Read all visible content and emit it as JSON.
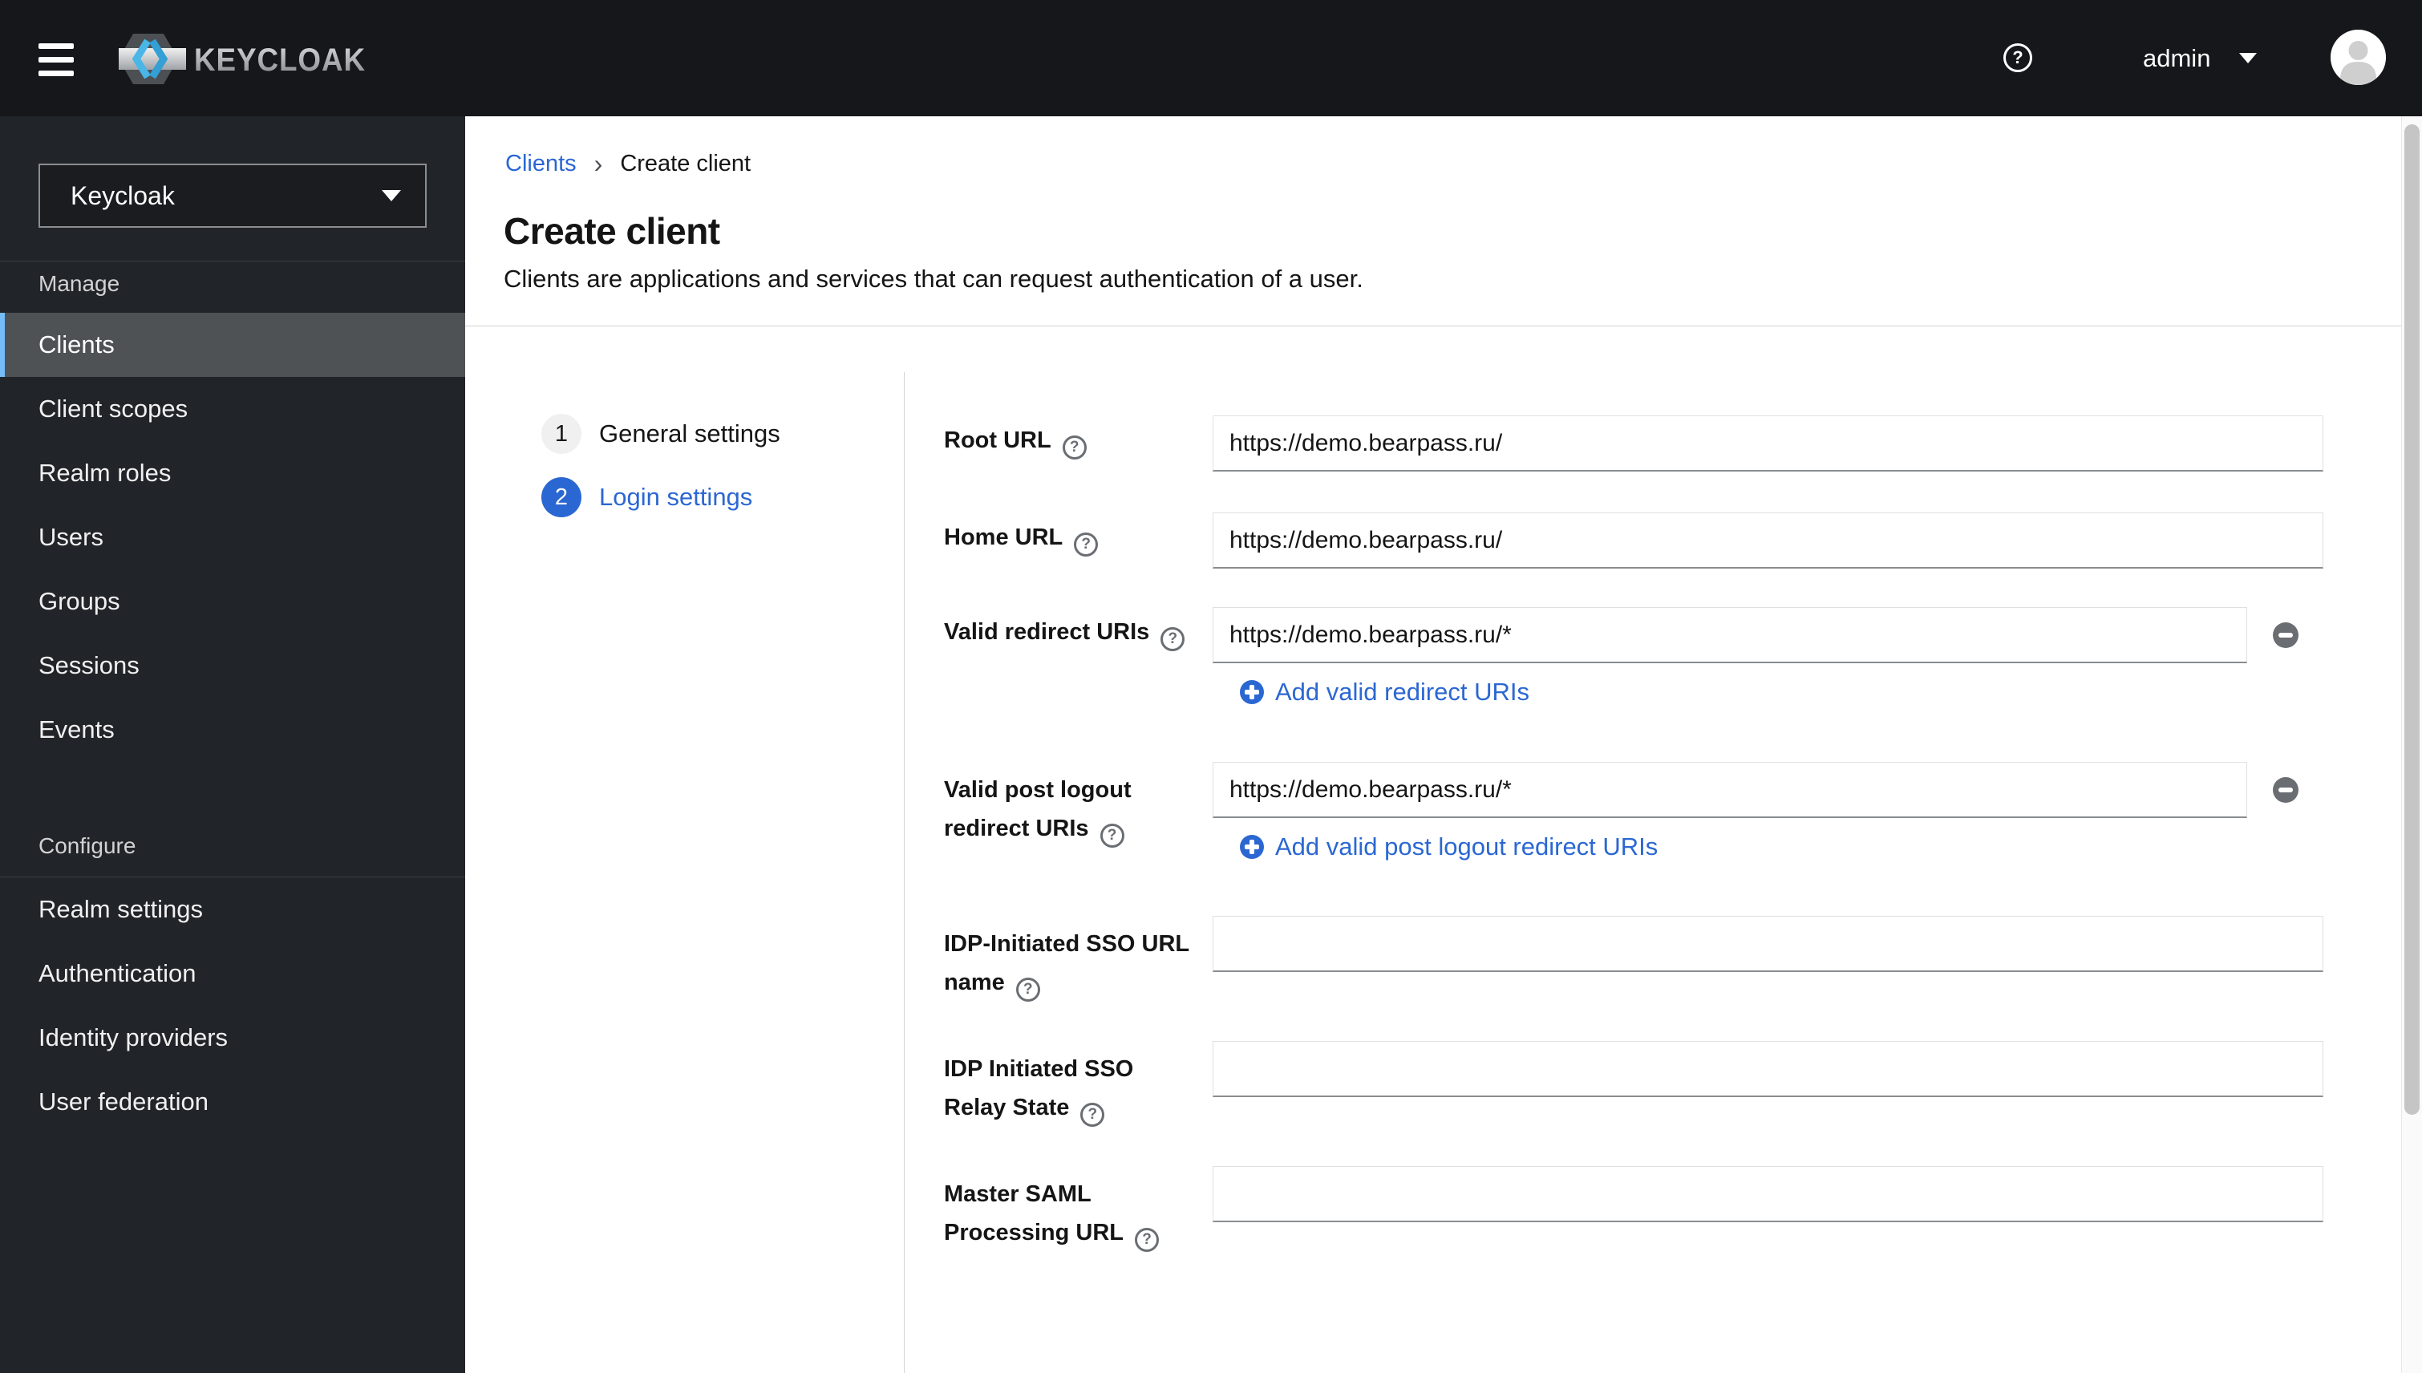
{
  "colors": {
    "header_bg": "#15171a",
    "sidebar_bg": "#212428",
    "accent_blue": "#2b67d2",
    "selected_nav_bar": "#73bcf7",
    "selected_nav_bg": "#4f5255",
    "icon_gray": "#6a6e73",
    "input_bottom_border": "#8a8d90",
    "divider": "#d2d2d2"
  },
  "icons": {
    "help_glyph": "?",
    "breadcrumb_separator": "›"
  },
  "header": {
    "product": "KEYCLOAK",
    "user": "admin"
  },
  "sidebar": {
    "realm_selector": {
      "value": "Keycloak"
    },
    "sections": [
      {
        "label": "Manage",
        "items": [
          {
            "label": "Clients",
            "selected": true
          },
          {
            "label": "Client scopes",
            "selected": false
          },
          {
            "label": "Realm roles",
            "selected": false
          },
          {
            "label": "Users",
            "selected": false
          },
          {
            "label": "Groups",
            "selected": false
          },
          {
            "label": "Sessions",
            "selected": false
          },
          {
            "label": "Events",
            "selected": false
          }
        ]
      },
      {
        "label": "Configure",
        "items": [
          {
            "label": "Realm settings",
            "selected": false
          },
          {
            "label": "Authentication",
            "selected": false
          },
          {
            "label": "Identity providers",
            "selected": false
          },
          {
            "label": "User federation",
            "selected": false
          }
        ]
      }
    ]
  },
  "breadcrumb": {
    "items": [
      "Clients",
      "Create client"
    ]
  },
  "page": {
    "title": "Create client",
    "subtitle": "Clients are applications and services that can request authentication of a user."
  },
  "wizard": {
    "steps": [
      {
        "number": "1",
        "label": "General settings",
        "active": false
      },
      {
        "number": "2",
        "label": "Login settings",
        "active": true
      }
    ]
  },
  "form": {
    "fields": [
      {
        "label": "Root URL",
        "label_lines": [
          "Root URL"
        ],
        "value": "https://demo.bearpass.ru/"
      },
      {
        "label": "Home URL",
        "label_lines": [
          "Home URL"
        ],
        "value": "https://demo.bearpass.ru/"
      },
      {
        "label": "Valid redirect URIs",
        "label_lines": [
          "Valid redirect URIs"
        ],
        "value": "https://demo.bearpass.ru/*",
        "add_label": "Add valid redirect URIs"
      },
      {
        "label": "Valid post logout redirect URIs",
        "label_lines": [
          "Valid post logout",
          "redirect URIs"
        ],
        "value": "https://demo.bearpass.ru/*",
        "add_label": "Add valid post logout redirect URIs"
      },
      {
        "label": "IDP-Initiated SSO URL name",
        "label_lines": [
          "IDP-Initiated SSO URL",
          "name"
        ],
        "value": ""
      },
      {
        "label": "IDP Initiated SSO Relay State",
        "label_lines": [
          "IDP Initiated SSO",
          "Relay State"
        ],
        "value": ""
      },
      {
        "label": "Master SAML Processing URL",
        "label_lines": [
          "Master SAML",
          "Processing URL"
        ],
        "value": ""
      }
    ]
  }
}
